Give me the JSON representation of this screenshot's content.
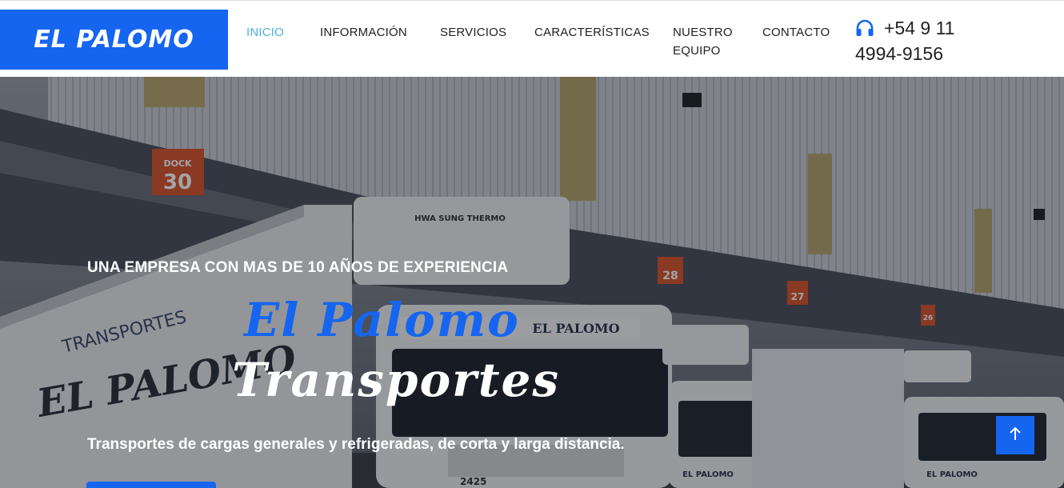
{
  "brand": {
    "logo_text": "EL PALOMO",
    "color": "#1565f0"
  },
  "nav": {
    "items": [
      {
        "label": "INICIO",
        "active": true
      },
      {
        "label": "INFORMACIÓN",
        "active": false
      },
      {
        "label": "SERVICIOS",
        "active": false
      },
      {
        "label": "CARACTERÍSTICAS",
        "active": false
      },
      {
        "label": "NUESTRO",
        "label2": "EQUIPO",
        "active": false
      },
      {
        "label": "CONTACTO",
        "active": false
      }
    ],
    "active_color": "#4fb0e0"
  },
  "contact": {
    "icon": "headset-icon",
    "phone_line1": "+54 9 11",
    "phone_line2": "4994-9156"
  },
  "hero": {
    "eyebrow": "UNA EMPRESA CON MAS DE 10 AÑOS DE EXPERIENCIA",
    "title_line1": "El Palomo",
    "title_line2": "Transportes",
    "subtitle": "Transportes de cargas generales y refrigeradas, de corta y larga distancia.",
    "background": {
      "dock_signs": [
        "DOCK",
        "30",
        "28",
        "27",
        "26"
      ],
      "truck_text": [
        "TRANSPORTES",
        "EL PALOMO",
        "HWA SUNG THERMO",
        "EL PALOMO",
        "2425",
        "EL PALOMO",
        "EL PALOMO"
      ]
    }
  },
  "back_to_top": {
    "icon": "arrow-up-icon"
  }
}
